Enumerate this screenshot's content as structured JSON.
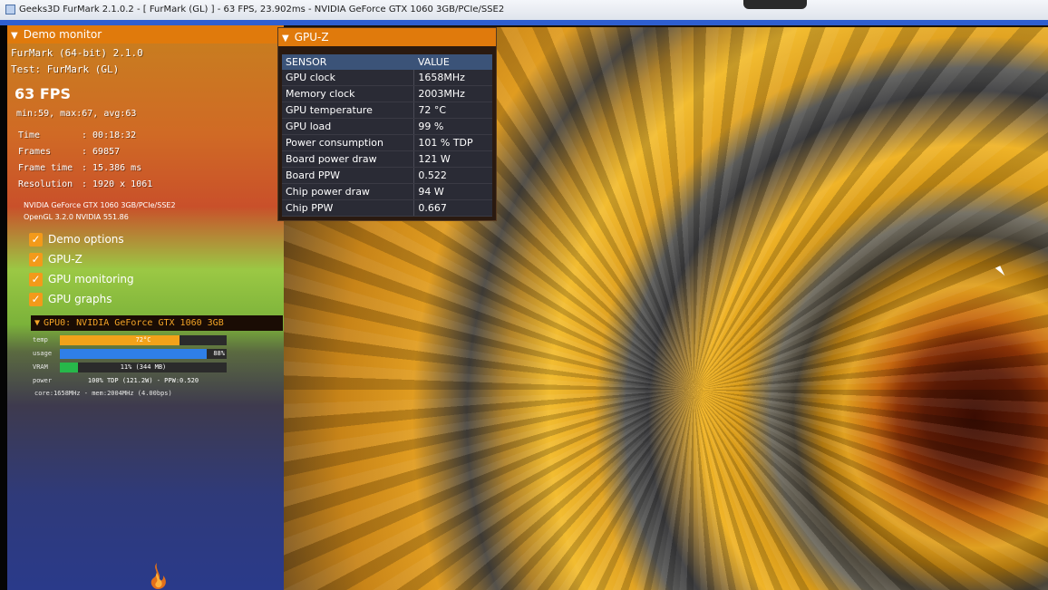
{
  "window": {
    "title": "Geeks3D FurMark 2.1.0.2 - [ FurMark (GL) ] - 63 FPS, 23.902ms - NVIDIA GeForce GTX 1060 3GB/PCIe/SSE2"
  },
  "demo_monitor": {
    "header": "Demo monitor",
    "app_name": "FurMark (64-bit) 2.1.0",
    "test": "Test: FurMark (GL)",
    "fps": "63 FPS",
    "fps_stats": "min:59, max:67, avg:63",
    "stats": [
      {
        "label": "Time",
        "value": ": 00:18:32"
      },
      {
        "label": "Frames",
        "value": ": 69857"
      },
      {
        "label": "Frame time",
        "value": ": 15.386 ms"
      },
      {
        "label": "Resolution",
        "value": ": 1920 x 1061"
      }
    ],
    "renderer": "NVIDIA GeForce GTX 1060 3GB/PCIe/SSE2",
    "opengl": "OpenGL 3.2.0 NVIDIA 551.86",
    "options": [
      {
        "label": "Demo options",
        "checked": true
      },
      {
        "label": "GPU-Z",
        "checked": true
      },
      {
        "label": "GPU monitoring",
        "checked": true
      },
      {
        "label": "GPU graphs",
        "checked": true
      }
    ],
    "check_glyph": "✓"
  },
  "gpu_monitor": {
    "header": "GPU0: NVIDIA GeForce GTX 1060 3GB",
    "bars": [
      {
        "label": "temp",
        "text": "72°C",
        "fill": 0.72,
        "color": "#f2a21a"
      },
      {
        "label": "usage",
        "text": "88%",
        "fill": 0.88,
        "color": "#2f7fe8"
      },
      {
        "label": "VRAM",
        "text": "11% (344 MB)",
        "fill": 0.11,
        "color": "#27b84a"
      },
      {
        "label": "power",
        "text": "100% TDP (121.2W) - PPW:0.520",
        "fill": 0.0,
        "color": "#2b2b2b"
      }
    ],
    "clocks": "core:1658MHz - mem:2004MHz (4.00bps)"
  },
  "gpuz": {
    "header": "GPU-Z",
    "columns": [
      "SENSOR",
      "VALUE"
    ],
    "rows": [
      [
        "GPU clock",
        "1658MHz"
      ],
      [
        "Memory clock",
        "2003MHz"
      ],
      [
        "GPU temperature",
        "72 °C"
      ],
      [
        "GPU load",
        "99 %"
      ],
      [
        "Power consumption",
        "101 % TDP"
      ],
      [
        "Board power draw",
        "121 W"
      ],
      [
        "Board PPW",
        "0.522"
      ],
      [
        "Chip power draw",
        "94 W"
      ],
      [
        "Chip PPW",
        "0.667"
      ]
    ]
  },
  "icons": {
    "collapse": "▼",
    "app": "window-icon",
    "logo": "furmark-flame-logo"
  },
  "colors": {
    "accent": "#e07a0c",
    "table_header": "#3b5378"
  }
}
